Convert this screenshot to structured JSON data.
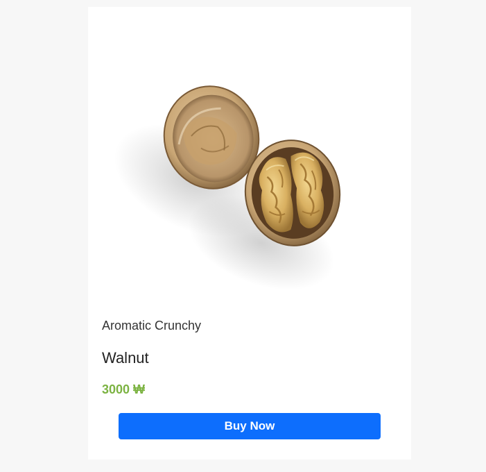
{
  "product": {
    "image_subject": "walnut-halves",
    "subtitle": "Aromatic Crunchy",
    "name": "Walnut",
    "price": "3000 ₩",
    "buy_label": "Buy Now"
  },
  "colors": {
    "background": "#f7f7f7",
    "card": "#ffffff",
    "price": "#7cb342",
    "button": "#0d6efd",
    "button_text": "#ffffff"
  }
}
